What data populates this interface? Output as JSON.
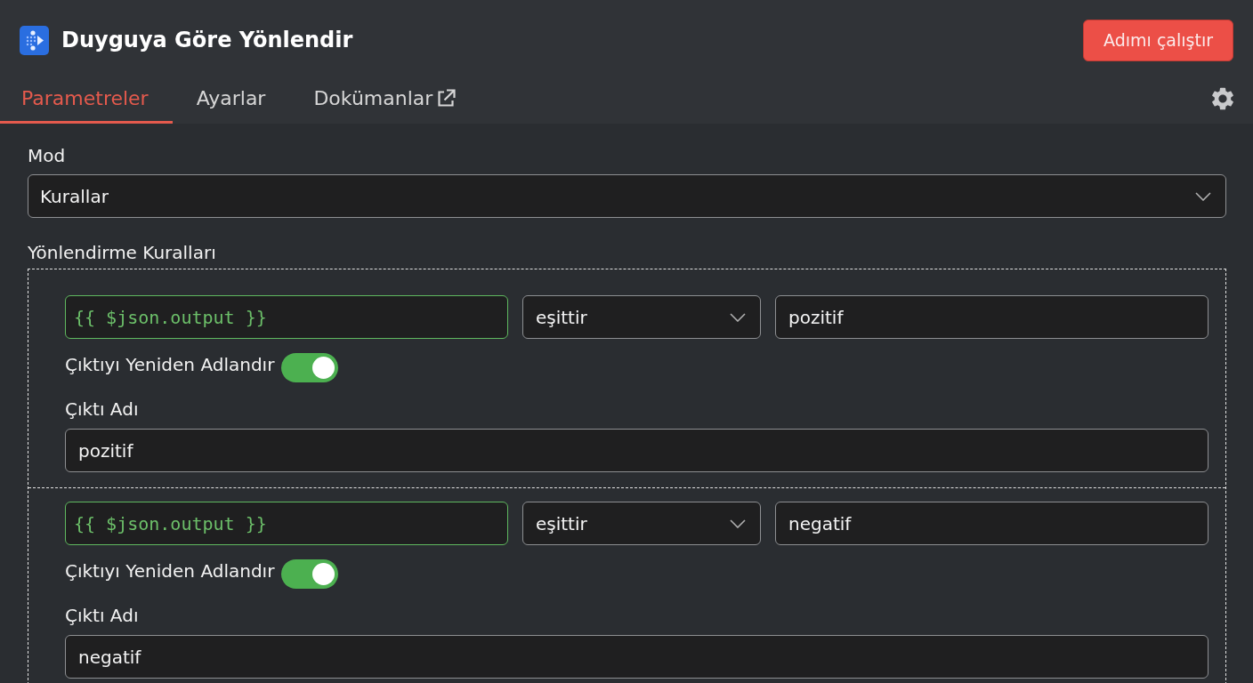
{
  "header": {
    "title": "Duyguya Göre Yönlendir",
    "run_button": "Adımı çalıştır"
  },
  "tabs": [
    {
      "label": "Parametreler",
      "kind": "tab",
      "selected": true
    },
    {
      "label": "Ayarlar",
      "kind": "tab",
      "selected": false
    },
    {
      "label": "Dokümanlar",
      "kind": "external",
      "selected": false
    }
  ],
  "mode": {
    "label": "Mod",
    "value": "Kurallar"
  },
  "routing_rules": {
    "label": "Yönlendirme Kuralları",
    "rules": [
      {
        "expression": "{{ $json.output }}",
        "operator": "eşittir",
        "value": "pozitif",
        "rename_output": {
          "label": "Çıktıyı Yeniden Adlandır",
          "on": true
        },
        "output_name": {
          "label": "Çıktı Adı",
          "value": "pozitif"
        }
      },
      {
        "expression": "{{ $json.output }}",
        "operator": "eşittir",
        "value": "negatif",
        "rename_output": {
          "label": "Çıktıyı Yeniden Adlandır",
          "on": true
        },
        "output_name": {
          "label": "Çıktı Adı",
          "value": "negatif"
        }
      }
    ]
  }
}
